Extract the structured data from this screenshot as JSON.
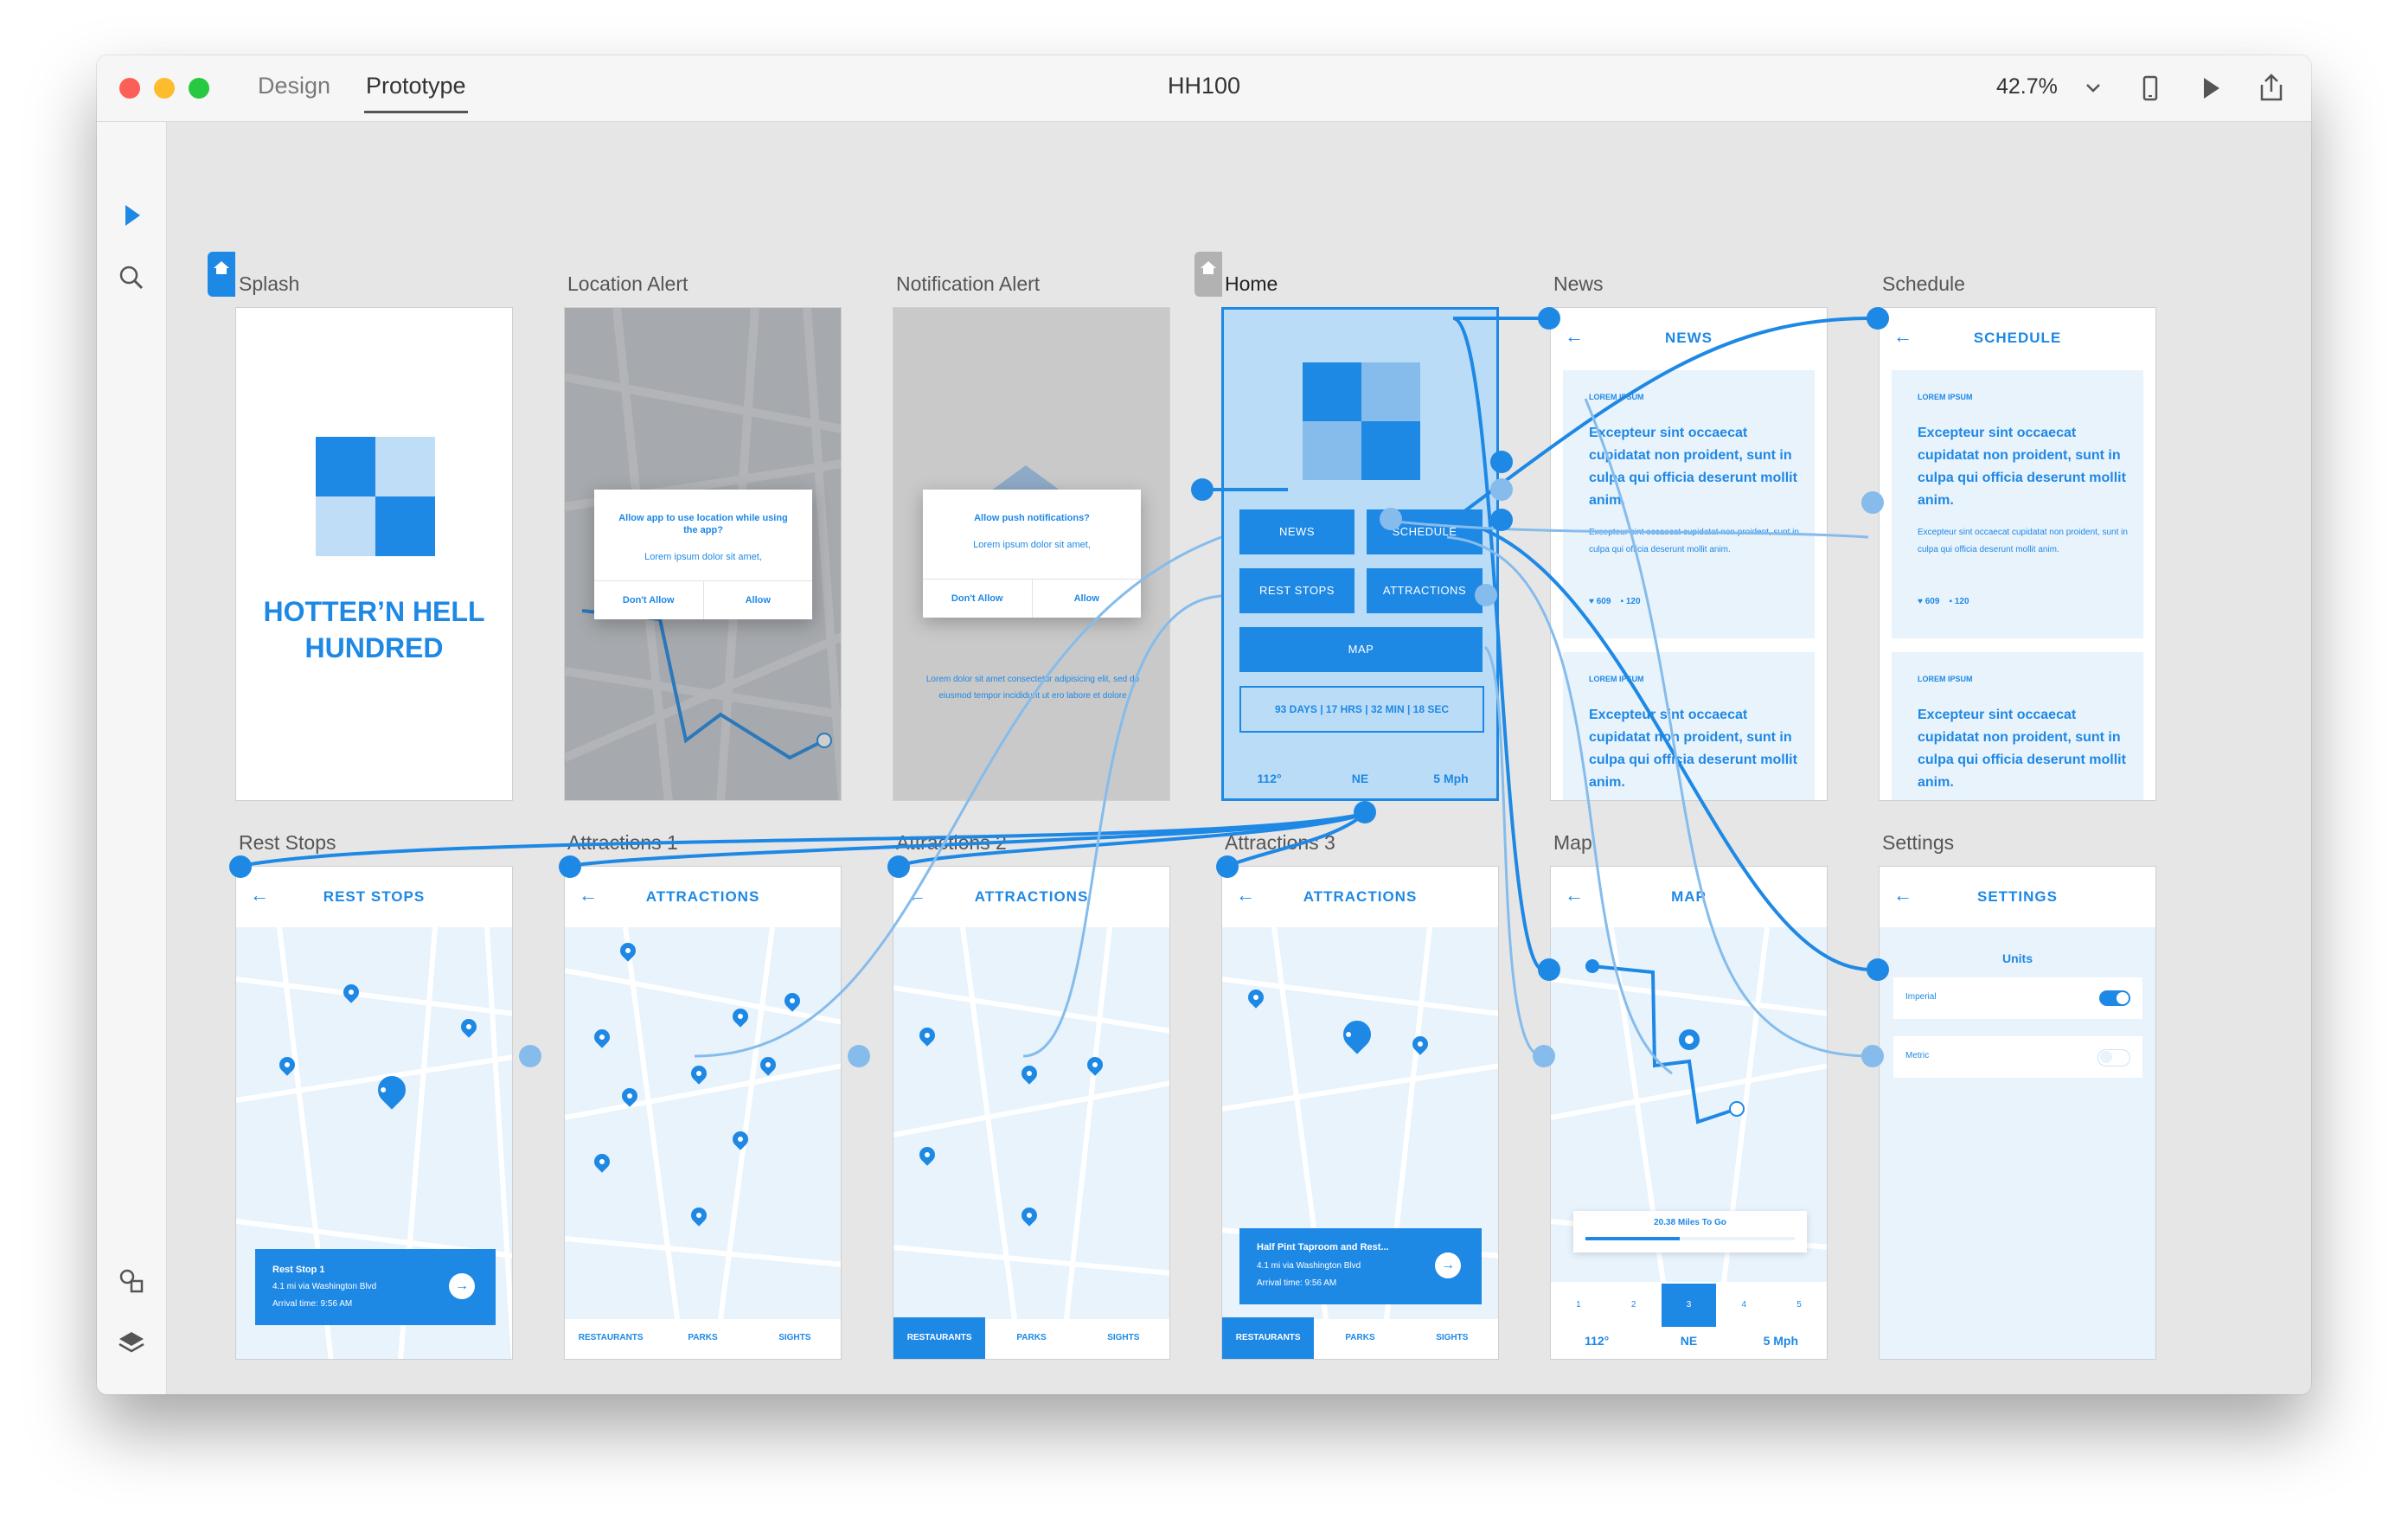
{
  "window": {
    "tabs": [
      "Design",
      "Prototype"
    ],
    "active_tab": "Prototype",
    "title": "HH100",
    "zoom": "42.7%"
  },
  "icons": {
    "select": "pointer-arrow-icon",
    "search": "search-icon",
    "assets": "assets-icon",
    "layers": "layers-icon",
    "device": "phone-preview-icon",
    "play": "play-icon",
    "share": "share-icon",
    "zoom_menu": "chevron-down-icon"
  },
  "colors": {
    "accent": "#1e88e5",
    "light_accent": "#e9f3fc",
    "mid_accent": "#85bcec"
  },
  "artboards": {
    "splash": {
      "label": "Splash",
      "title_line1": "HOTTER’N HELL",
      "title_line2": "HUNDRED"
    },
    "location_alert": {
      "label": "Location Alert",
      "alert_title": "Allow app to use location while using the app?",
      "alert_body": "Lorem ipsum dolor sit amet,",
      "btn_deny": "Don't Allow",
      "btn_allow": "Allow"
    },
    "notification_alert": {
      "label": "Notification Alert",
      "alert_title": "Allow push notifications?",
      "alert_body": "Lorem ipsum dolor sit amet,",
      "btn_deny": "Don't Allow",
      "btn_allow": "Allow",
      "footer": "Lorem dolor sit amet consectetur adipisicing elit, sed do eiusmod tempor incididunt ut ero labore et dolore"
    },
    "home": {
      "label": "Home",
      "btn_news": "NEWS",
      "btn_schedule": "SCHEDULE",
      "btn_rest": "REST STOPS",
      "btn_attractions": "ATTRACTIONS",
      "btn_map": "MAP",
      "countdown": "93 DAYS | 17 HRS | 32 MIN | 18 SEC",
      "temp": "112°",
      "wind_dir": "NE",
      "wind_speed": "5 Mph"
    },
    "news": {
      "label": "News",
      "header": "NEWS",
      "tag": "LOREM IPSUM",
      "headline": "Excepteur sint occaecat cupidatat non proident, sunt in culpa qui officia deserunt mollit anim.",
      "body": "Excepteur sint occaecat cupidatat non proident, sunt in culpa qui officia deserunt mollit anim.",
      "likes": "609",
      "comments": "120"
    },
    "schedule": {
      "label": "Schedule",
      "header": "SCHEDULE",
      "tag": "LOREM IPSUM",
      "headline": "Excepteur sint occaecat cupidatat non proident, sunt in culpa qui officia deserunt mollit anim.",
      "body": "Excepteur sint occaecat cupidatat non proident, sunt in culpa qui officia deserunt mollit anim.",
      "likes": "609",
      "comments": "120"
    },
    "rest_stops": {
      "label": "Rest Stops",
      "header": "REST STOPS",
      "card_title": "Rest Stop 1",
      "card_line1": "4.1 mi via Washington Blvd",
      "card_line2": "Arrival time: 9:56 AM"
    },
    "attractions1": {
      "label": "Attractions 1",
      "header": "ATTRACTIONS"
    },
    "attractions2": {
      "label": "Attractions 2",
      "header": "ATTRACTIONS"
    },
    "attractions3": {
      "label": "Attractions 3",
      "header": "ATTRACTIONS",
      "card_title": "Half Pint Taproom and Rest...",
      "card_line1": "4.1 mi via Washington Blvd",
      "card_line2": "Arrival time: 9:56 AM"
    },
    "map": {
      "label": "Map",
      "header": "MAP",
      "miles": "20.38 Miles To Go",
      "steps": [
        "1",
        "2",
        "3",
        "4",
        "5"
      ],
      "active_step": "3",
      "temp": "112°",
      "wind_dir": "NE",
      "wind_speed": "5 Mph"
    },
    "settings": {
      "label": "Settings",
      "header": "SETTINGS",
      "section": "Units",
      "opt1": "Imperial",
      "opt2": "Metric"
    }
  },
  "bottom_tabs": [
    "RESTAURANTS",
    "PARKS",
    "SIGHTS"
  ]
}
